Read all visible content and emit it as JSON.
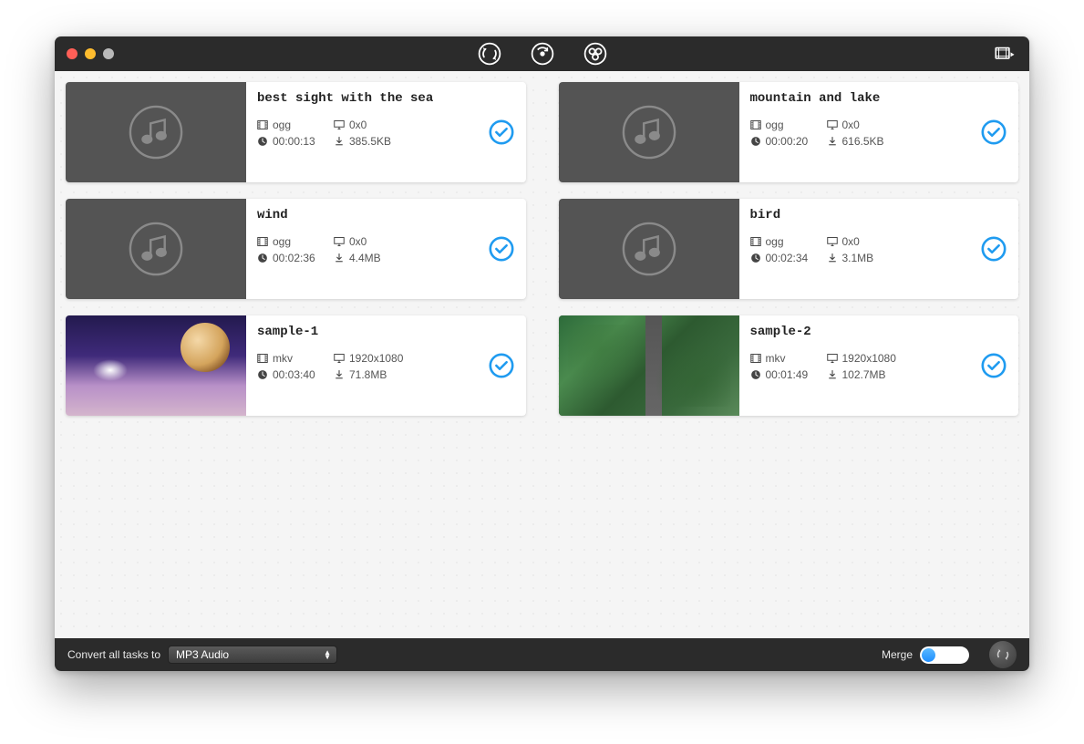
{
  "footer": {
    "convert_label": "Convert all tasks to",
    "format_selected": "MP3 Audio",
    "merge_label": "Merge",
    "merge_on": false
  },
  "accent": "#1f9bf0",
  "items": [
    {
      "title": "best sight with the sea",
      "format": "ogg",
      "resolution": "0x0",
      "duration": "00:00:13",
      "size": "385.5KB",
      "thumb": "audio"
    },
    {
      "title": "mountain and lake",
      "format": "ogg",
      "resolution": "0x0",
      "duration": "00:00:20",
      "size": "616.5KB",
      "thumb": "audio"
    },
    {
      "title": "wind",
      "format": "ogg",
      "resolution": "0x0",
      "duration": "00:02:36",
      "size": "4.4MB",
      "thumb": "audio"
    },
    {
      "title": "bird",
      "format": "ogg",
      "resolution": "0x0",
      "duration": "00:02:34",
      "size": "3.1MB",
      "thumb": "audio"
    },
    {
      "title": "sample-1",
      "format": "mkv",
      "resolution": "1920x1080",
      "duration": "00:03:40",
      "size": "71.8MB",
      "thumb": "video1"
    },
    {
      "title": "sample-2",
      "format": "mkv",
      "resolution": "1920x1080",
      "duration": "00:01:49",
      "size": "102.7MB",
      "thumb": "video2"
    }
  ]
}
